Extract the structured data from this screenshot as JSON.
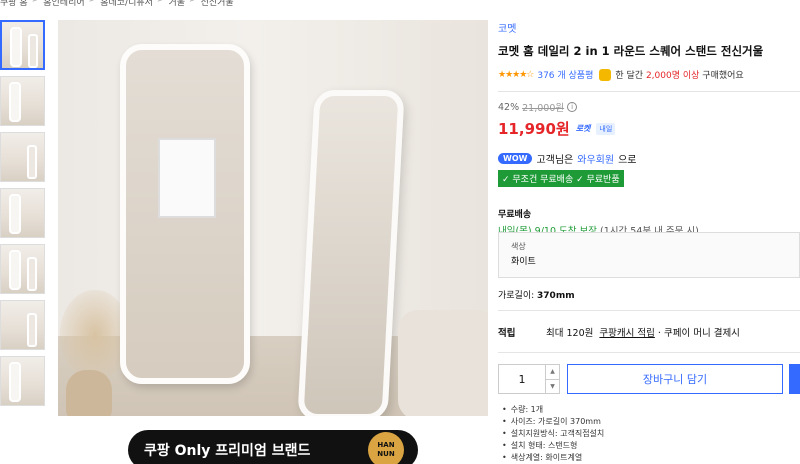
{
  "breadcrumb": [
    "쿠팡 홈",
    "홈인테리어",
    "홈데코/디퓨저",
    "거울",
    "전신거울"
  ],
  "thumbnails": [
    {
      "id": 1,
      "active": true
    },
    {
      "id": 2,
      "active": false
    },
    {
      "id": 3,
      "active": false
    },
    {
      "id": 4,
      "active": false
    },
    {
      "id": 5,
      "active": false
    },
    {
      "id": 6,
      "active": false
    },
    {
      "id": 7,
      "active": false
    }
  ],
  "promo": {
    "text": "쿠팡 Only 프리미엄 브랜드",
    "badge": "HAN NUN"
  },
  "product": {
    "brand": "코멧",
    "title": "코멧 홈 데일리 2 in 1 라운드 스퀘어 스탠드 전신거울",
    "stars": "★★★★☆",
    "review_count": "376 개 상품평",
    "buy_prefix": "한 달간",
    "buy_count": "2,000명 이상",
    "buy_suffix": "구매했어요"
  },
  "price": {
    "discount": "42%",
    "original": "21,000원",
    "info_icon": "i",
    "sale": "11,990원",
    "rocket": "로켓",
    "naeil": "내일"
  },
  "membership": {
    "wow": "WOW",
    "prefix": "고객님은",
    "link": "와우회원",
    "suffix": "으로",
    "free_text": "✓ 무조건 무료배송 ✓ 무료반품"
  },
  "shipping": {
    "label": "무료배송",
    "date": "내일(목) 9/10",
    "guarantee": "도착 보장",
    "note": "(1시간 54분 내 주문 시)"
  },
  "option": {
    "label": "색상",
    "value": "화이트"
  },
  "width": {
    "label": "가로길이:",
    "value": "370mm"
  },
  "points": {
    "label": "적립",
    "text1": "최대 120원",
    "link": "쿠팡캐시 적립",
    "text2": "· 쿠페이 머니 결제시"
  },
  "quantity": {
    "value": "1",
    "up": "▲",
    "down": "▼"
  },
  "cart_label": "장바구니 담기",
  "specs": [
    "수량: 1개",
    "사이즈: 가로길이 370mm",
    "설치지원방식: 고객직접설치",
    "설치 형태: 스탠드형",
    "색상계열: 화이트계열"
  ]
}
